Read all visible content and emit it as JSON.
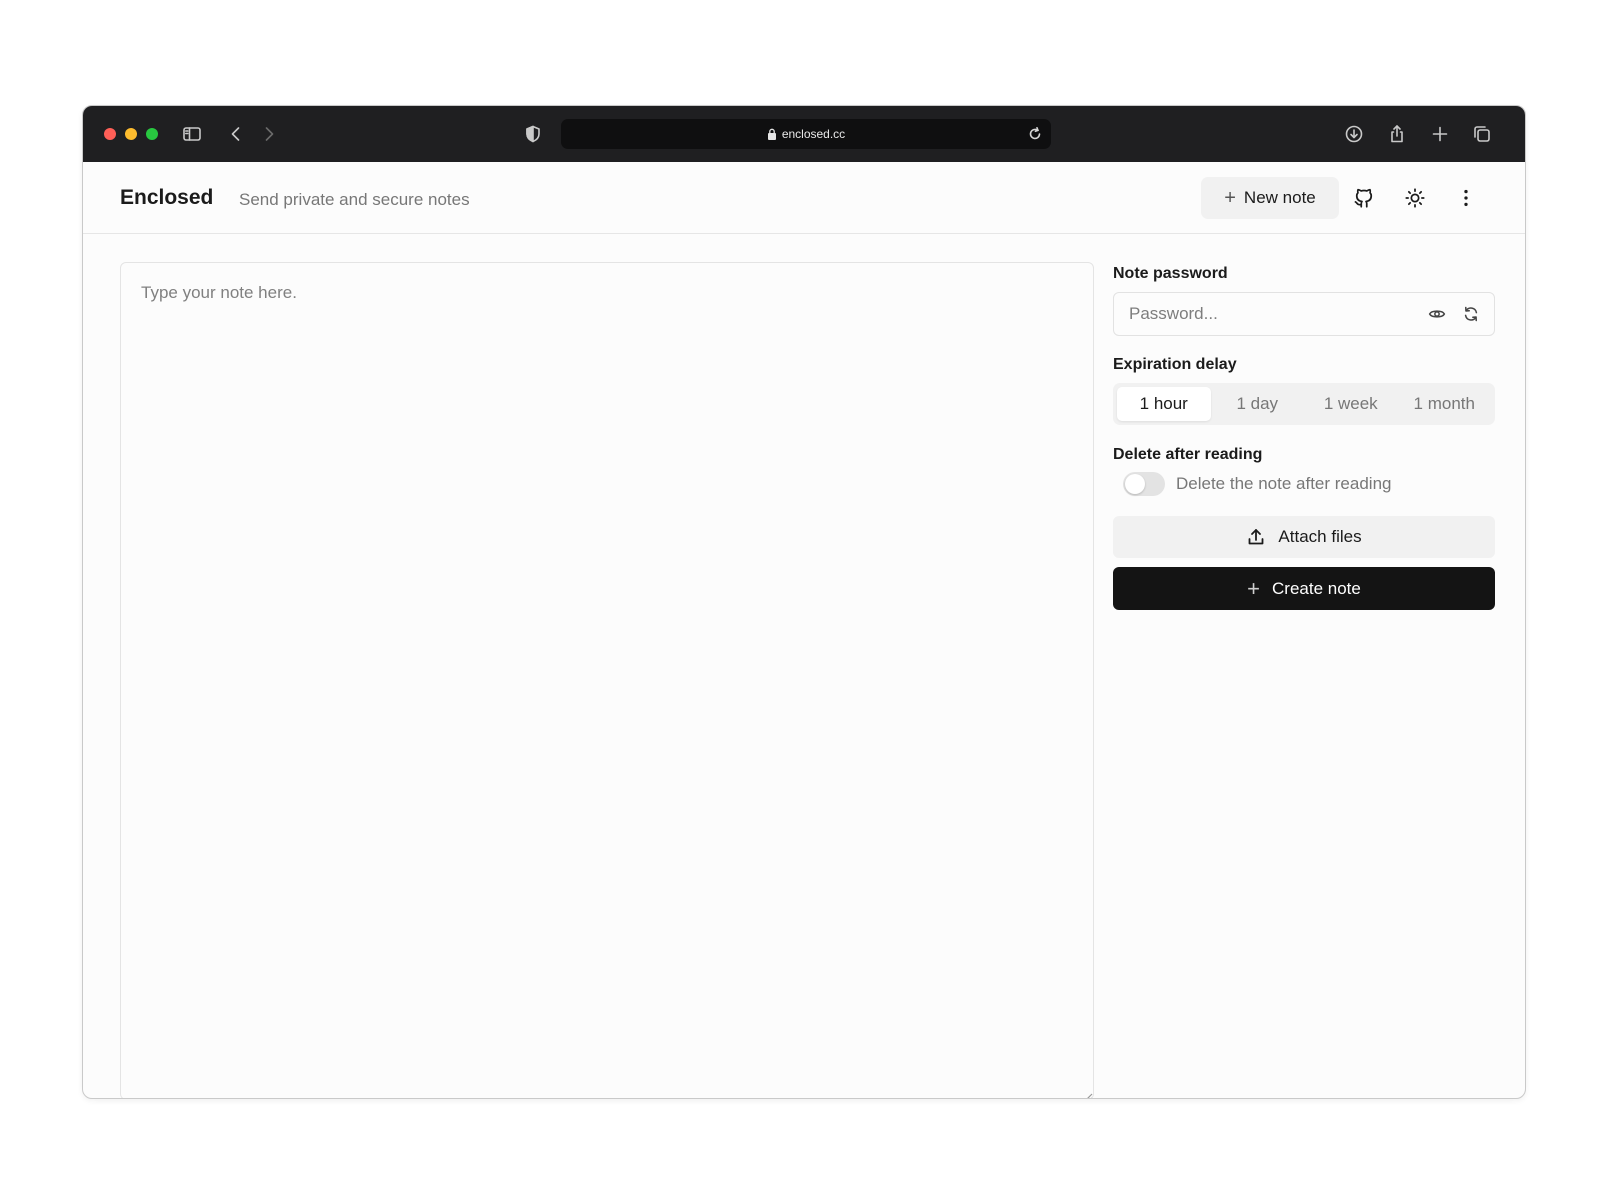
{
  "browser": {
    "url": "enclosed.cc",
    "icons": {
      "sidebar": "sidebar-icon",
      "back": "chevron-left-icon",
      "forward": "chevron-right-icon",
      "shield": "shield-icon",
      "lock": "lock-icon",
      "reload": "reload-icon",
      "download": "download-icon",
      "share": "share-icon",
      "new_tab": "plus-icon",
      "tabs": "tabs-icon"
    }
  },
  "header": {
    "brand": "Enclosed",
    "tagline": "Send private and secure notes",
    "new_note_label": "New note",
    "icons": [
      "github-icon",
      "sun-icon",
      "more-vertical-icon"
    ]
  },
  "editor": {
    "placeholder": "Type your note here.",
    "value": ""
  },
  "sidebar": {
    "password_label": "Note password",
    "password_placeholder": "Password...",
    "expiration_label": "Expiration delay",
    "expiration_options": [
      "1 hour",
      "1 day",
      "1 week",
      "1 month"
    ],
    "expiration_selected": "1 hour",
    "delete_label": "Delete after reading",
    "delete_toggle_text": "Delete the note after reading",
    "delete_toggle_on": false,
    "attach_label": "Attach files",
    "create_label": "Create note"
  },
  "colors": {
    "primary_button": "#141414",
    "muted_text": "#777777",
    "chrome": "#1f1f21"
  }
}
